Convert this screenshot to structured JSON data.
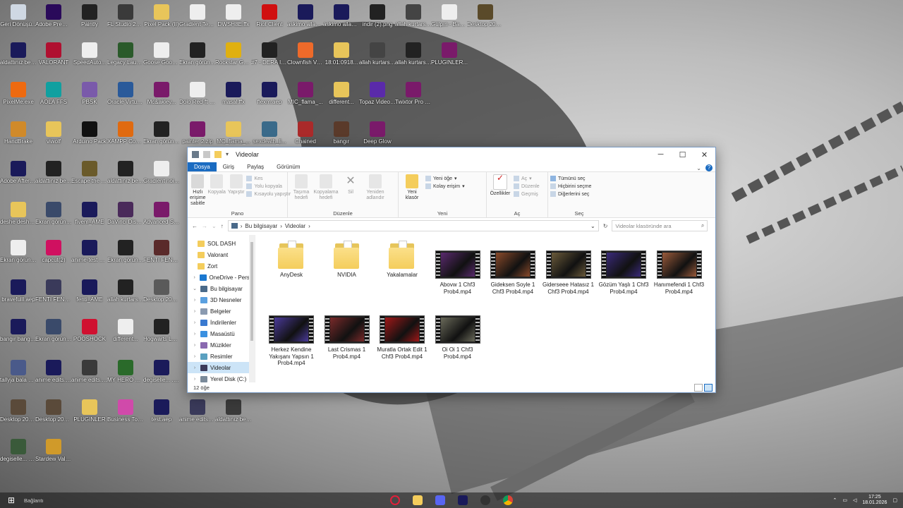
{
  "window": {
    "title": "Videolar",
    "tabs": [
      "Dosya",
      "Giriş",
      "Paylaş",
      "Görünüm"
    ],
    "ribbon": {
      "pano": {
        "name": "Pano",
        "pin": "Hızlı erişime sabitle",
        "copy": "Kopyala",
        "paste": "Yapıştır",
        "cut": "Kes",
        "copy_path": "Yolu kopyala",
        "paste_shortcut": "Kısayolu yapıştır"
      },
      "duzenle": {
        "name": "Düzenle",
        "move_to": "Taşıma hedefi",
        "copy_to": "Kopyalama hedefi",
        "delete": "Sil",
        "rename": "Yeniden adlandır"
      },
      "yeni": {
        "name": "Yeni",
        "new_folder": "Yeni klasör",
        "new_item": "Yeni öğe",
        "easy_access": "Kolay erişim"
      },
      "ac": {
        "name": "Aç",
        "properties": "Özellikler",
        "open": "Aç",
        "edit": "Düzenle",
        "history": "Geçmiş"
      },
      "sec": {
        "name": "Seç",
        "select_all": "Tümünü seç",
        "select_none": "Hiçbirini seçme",
        "invert": "Diğerlerini seç"
      }
    },
    "address": {
      "root": "Bu bilgisayar",
      "current": "Videolar",
      "search_placeholder": "Videolar klasöründe ara"
    },
    "nav": [
      {
        "label": "SOL DASH",
        "kind": "folder"
      },
      {
        "label": "Valorant",
        "kind": "folder"
      },
      {
        "label": "Zort",
        "kind": "folder"
      },
      {
        "label": "OneDrive - Persor",
        "kind": "cloud"
      },
      {
        "label": "Bu bilgisayar",
        "kind": "pc"
      },
      {
        "label": "3D Nesneler",
        "kind": "3d"
      },
      {
        "label": "Belgeler",
        "kind": "doc"
      },
      {
        "label": "İndirilenler",
        "kind": "down"
      },
      {
        "label": "Masaüstü",
        "kind": "desk"
      },
      {
        "label": "Müzikler",
        "kind": "music"
      },
      {
        "label": "Resimler",
        "kind": "pic"
      },
      {
        "label": "Videolar",
        "kind": "video"
      },
      {
        "label": "Yerel Disk (C:)",
        "kind": "disk"
      }
    ],
    "items": [
      {
        "label": "AnyDesk",
        "kind": "folder"
      },
      {
        "label": "NVIDIA",
        "kind": "folder"
      },
      {
        "label": "Yakalamalar",
        "kind": "folder"
      },
      {
        "label": "Abovw 1 Chf3 Prob4.mp4",
        "kind": "video",
        "color": "#5a2a6e"
      },
      {
        "label": "Gideksen Soyle 1 Chf3 Prob4.mp4",
        "kind": "video",
        "color": "#8a4a2a"
      },
      {
        "label": "Giderseee Hatasız 1 Chf3 Prob4.mp4",
        "kind": "video",
        "color": "#6a5a3a"
      },
      {
        "label": "Gözüm Yaşlı 1 Chf3 Prob4.mp4",
        "kind": "video",
        "color": "#3a2a7a"
      },
      {
        "label": "Hanımefendi 1 Chf3 Prob4.mp4",
        "kind": "video",
        "color": "#9a5a3a"
      },
      {
        "label": "Herkez Kendine Yakışanı Yapsın 1 Prob4.mp4",
        "kind": "video",
        "color": "#4a3a9a"
      },
      {
        "label": "Last Crismas 1 Prob4.mp4",
        "kind": "video",
        "color": "#7a2a2a"
      },
      {
        "label": "Muratla Ortak Edit 1 Chf3 Prob4.mp4",
        "kind": "video",
        "color": "#a01818"
      },
      {
        "label": "Oi Oi 1 Chf3 Prob4.mp4",
        "kind": "video",
        "color": "#6a6a5a"
      }
    ],
    "status": "12 öğe"
  },
  "desktop": [
    {
      "label": "Geri Dönüşü...",
      "color": "#cfd8e3"
    },
    {
      "label": "Adobe Premiere P...",
      "color": "#2a0a5a"
    },
    {
      "label": "Paintly",
      "color": "#222"
    },
    {
      "label": "FL Studio 2024",
      "color": "#3a3a3a"
    },
    {
      "label": "Pixel Pack (II)",
      "color": "#e8c55a"
    },
    {
      "label": "Gradient Textures",
      "color": "#eee"
    },
    {
      "label": "DWSH8E.ffx",
      "color": "#eee"
    },
    {
      "label": "Riot Client",
      "color": "#d01010"
    },
    {
      "label": "askimo allah kurtarsın...",
      "color": "#1a1a5a"
    },
    {
      "label": "askimo allah kurtarsın...",
      "color": "#1a1a5a"
    },
    {
      "label": "indir (2).png",
      "color": "#222"
    },
    {
      "label": "allah kurtarsın se...",
      "color": "#444"
    },
    {
      "label": "Gülpın - Bangır Ban...",
      "color": "#eee"
    },
    {
      "label": "Desktop 2026.01.05...",
      "color": "#5a4a2a"
    },
    {
      "label": "aldattınız beni.aep",
      "color": "#1a1a5a"
    },
    {
      "label": "VALORANT",
      "color": "#b01030"
    },
    {
      "label": "SpeedAuto...",
      "color": "#eee"
    },
    {
      "label": "Legacy Launch...",
      "color": "#2a5a2a"
    },
    {
      "label": "Goose Goose Duck",
      "color": "#eee"
    },
    {
      "label": "Ekran görüntüsü...",
      "color": "#222"
    },
    {
      "label": "Rockstar Games...",
      "color": "#e0b010"
    },
    {
      "label": "#7 - DERA INC (Offici...",
      "color": "#222"
    },
    {
      "label": "Clownfish Vo...",
      "color": "#ee6a2a"
    },
    {
      "label": "18:01:0918...",
      "color": "#e8c55a"
    },
    {
      "label": "allah kurtarsın se...",
      "color": "#444"
    },
    {
      "label": "allah kurtarsın se...",
      "color": "#222"
    },
    {
      "label": "PLUGINLER...",
      "color": "#7a1a6a"
    },
    {
      "label": "PixelMe.exe",
      "color": "#ee6a10"
    },
    {
      "label": "AOLA FFS",
      "color": "#10a0a0"
    },
    {
      "label": "PBSK",
      "color": "#7a5aaa"
    },
    {
      "label": "Oracle VirtualBox",
      "color": "#2a5a9a"
    },
    {
      "label": "Mc&akley...",
      "color": "#7a1a6a"
    },
    {
      "label": "Dolo Red-ft Ice Cut -...",
      "color": "#eee"
    },
    {
      "label": "masal.ffx",
      "color": "#1a1a5a"
    },
    {
      "label": "flexm.aep",
      "color": "#1a1a5a"
    },
    {
      "label": "MIC_flama_...",
      "color": "#7a1a6a"
    },
    {
      "label": "different...",
      "color": "#e8c55a"
    },
    {
      "label": "Topaz Video AI",
      "color": "#5a2aaa"
    },
    {
      "label": "Twixtor Pro v7.3.0 (2).rar",
      "color": "#7a1a6a"
    },
    {
      "label": "HandBrake",
      "color": "#d08a2a"
    },
    {
      "label": "viwolf",
      "color": "#e8c55a"
    },
    {
      "label": "Arduino Pack",
      "color": "#111"
    },
    {
      "label": "XAMPP Control Panel",
      "color": "#e06a10"
    },
    {
      "label": "Ekran görüntüsü...",
      "color": "#222"
    },
    {
      "label": "painter 2.zip",
      "color": "#7a1a6a"
    },
    {
      "label": "MC_flama_...",
      "color": "#e8c55a"
    },
    {
      "label": "sexdeath_li...",
      "color": "#3a6a8a"
    },
    {
      "label": "Chained",
      "color": "#aa2a2a"
    },
    {
      "label": "bangır",
      "color": "#5a3a2a"
    },
    {
      "label": "Deep Glow",
      "color": "#7a1a6a"
    },
    {
      "label": "Adobe After Effects A...",
      "color": "#1a1a5a"
    },
    {
      "label": "aldattınız beni(1) fkf...",
      "color": "#222"
    },
    {
      "label": "Escape the Backrooms",
      "color": "#6a5a2a"
    },
    {
      "label": "aldattınız beniaep...",
      "color": "#222"
    },
    {
      "label": "Gradient noir textures",
      "color": "#eee"
    },
    {
      "label": "deshe deshe.aep",
      "color": "#1a1a5a"
    },
    {
      "label": "denemeamp4",
      "color": "#3a3a5a"
    },
    {
      "label": "deshe deshe_AME",
      "color": "#e8c55a"
    },
    {
      "label": "Ekran görüntüsü...",
      "color": "#3a4a6a"
    },
    {
      "label": "fivem_AME",
      "color": "#1a1a5a"
    },
    {
      "label": "DaVinci Disco Demo",
      "color": "#4a2a5a"
    },
    {
      "label": "Advanced Soft 3D H...",
      "color": "#7a1a6a"
    },
    {
      "label": "Advanced Soft 3D H...",
      "color": "#e8c55a"
    },
    {
      "label": "Syloxyd V2.ffx",
      "color": "#eee"
    },
    {
      "label": "Ekran görüntüsü...",
      "color": "#eee"
    },
    {
      "label": "capcut(2)",
      "color": "#d01060"
    },
    {
      "label": "anime-test edit.aep",
      "color": "#1a1a5a"
    },
    {
      "label": "Ekran görüntüsü...",
      "color": "#222"
    },
    {
      "label": "FENTI FENTI TOPAZ...",
      "color": "#5a2a2a"
    },
    {
      "label": "18:01:29:18...",
      "color": "#7a1a6a"
    },
    {
      "label": "ch3 2024.mp4",
      "color": "#222"
    },
    {
      "label": "bravefulll.aep",
      "color": "#1a1a5a"
    },
    {
      "label": "FENTI FENTI TOPAZ4...",
      "color": "#3a3a5a"
    },
    {
      "label": "fenti_AME",
      "color": "#1a1a5a"
    },
    {
      "label": "allah kurtarsın se...",
      "color": "#222"
    },
    {
      "label": "Desktop 2026.01.04...",
      "color": "#5a5a5a"
    },
    {
      "label": "fenti fenti.mp4",
      "color": "#d08a6a"
    },
    {
      "label": "fenti.aep",
      "color": "#1a1a5a"
    },
    {
      "label": "bangır bangır.aep",
      "color": "#1a1a5a"
    },
    {
      "label": "Ekran görüntüsü...",
      "color": "#3a4a6a"
    },
    {
      "label": "POOSHOCK",
      "color": "#d01030"
    },
    {
      "label": "different...",
      "color": "#eee"
    },
    {
      "label": "Hogwarts Legacy",
      "color": "#222"
    },
    {
      "label": "Ekran görüntüsü...",
      "color": "#222"
    },
    {
      "label": "Desktop 2026.01.07...",
      "color": "#5a4a3a"
    },
    {
      "label": "tallyja bala chf3...",
      "color": "#4a5a8a"
    },
    {
      "label": "anime edits.aep",
      "color": "#1a1a5a"
    },
    {
      "label": "anime edits.amp4",
      "color": "#3a3a3a"
    },
    {
      "label": "MY HERO ULTRA...",
      "color": "#2a6a2a"
    },
    {
      "label": "degiselle... .aep",
      "color": "#1a1a5a"
    },
    {
      "label": "Five Nights at Freddy's",
      "color": "#6a3a1a"
    },
    {
      "label": "saselaat_A...",
      "color": "#1a1a5a"
    },
    {
      "label": "Desktop 2026.01.05...",
      "color": "#5a4a3a"
    },
    {
      "label": "Desktop 2026.01.07...",
      "color": "#5a4a3a"
    },
    {
      "label": "PLUGINLER",
      "color": "#e8c55a"
    },
    {
      "label": "Business Tour - Online M...",
      "color": "#d04aaa"
    },
    {
      "label": "test.aep",
      "color": "#1a1a5a"
    },
    {
      "label": "anime edits_chf3...",
      "color": "#3a3a5a"
    },
    {
      "label": "aldattınız beni_chf3...",
      "color": "#3a3a3a"
    },
    {
      "label": "degiselle... soyt.mp4",
      "color": "#3a5a3a"
    },
    {
      "label": "Stardew Valley",
      "color": "#d09a2a"
    }
  ],
  "taskbar": {
    "search": "Bağlantı",
    "time": "17:25",
    "date": "18.01.2026"
  }
}
